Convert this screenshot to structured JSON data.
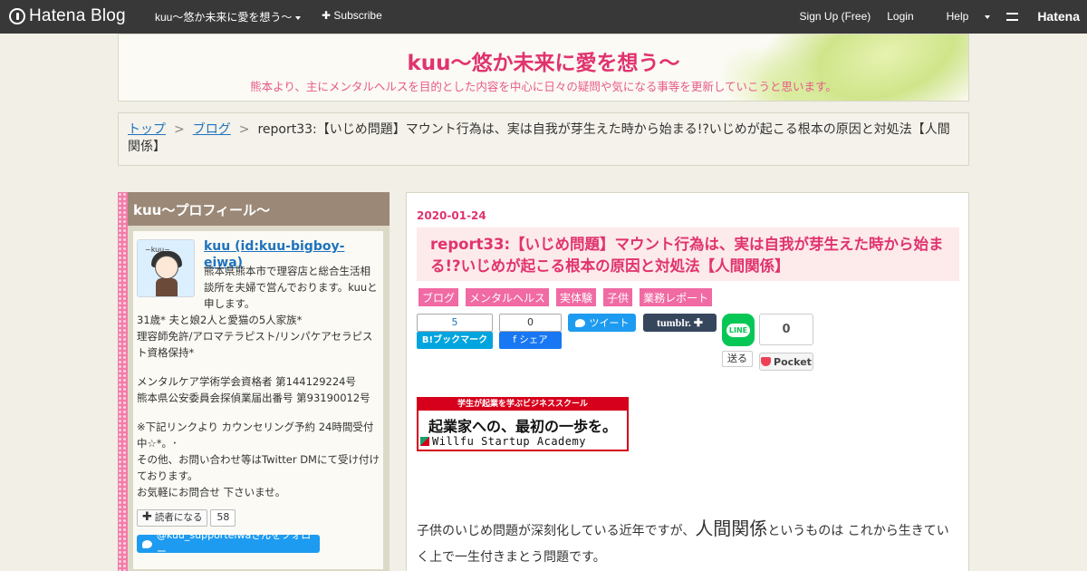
{
  "topbar": {
    "logo_text": "Hatena Blog",
    "blog_name": "kuu～悠か未来に愛を想う～",
    "subscribe": "Subscribe",
    "signup": "Sign Up (Free)",
    "login": "Login",
    "help": "Help",
    "hatena": "Hatena"
  },
  "header": {
    "title": "kuu～悠か未来に愛を想う～",
    "description": "熊本より、主にメンタルヘルスを目的とした内容を中心に日々の疑問や気になる事等を更新していこうと思います。"
  },
  "breadcrumb": {
    "top": "トップ",
    "blog": "ブログ",
    "sep": ">",
    "current": "report33:【いじめ問題】マウント行為は、実は自我が芽生えた時から始まる!?いじめが起こる根本の原因と対処法【人間関係】"
  },
  "sidebar": {
    "module_title": "kuu～プロフィール～",
    "avatar_caption": "~kuu~",
    "profile_name": "kuu (id:kuu-bigboy-eiwa)",
    "intro": "熊本県熊本市で理容店と総合生活相談所を夫婦で営んでおります。kuuと申します。",
    "line1": "31歳* 夫と娘2人と愛猫の5人家族*",
    "line2": "理容師免許/アロマテラピスト/リンパケアセラピスト資格保持*",
    "line3": "メンタルケア学術学会資格者 第144129224号",
    "line4": "熊本県公安委員会探偵業届出番号 第93190012号",
    "line5": "※下記リンクより カウンセリング予約 24時間受付中☆*。･",
    "line6": "その他、お問い合わせ等はTwitter DMにて受け付けております。",
    "line7": "お気軽にお問合せ 下さいませ。",
    "reader_button": "読者になる",
    "reader_count": "58",
    "twitter_follow": "@kuu_supporteiwaさんをフォロー"
  },
  "entry": {
    "date": "2020-01-24",
    "title": "report33:【いじめ問題】マウント行為は、実は自我が芽生えた時から始まる!?いじめが起こる根本の原因と対処法【人間関係】",
    "categories": [
      "ブログ",
      "メンタルヘルス",
      "実体験",
      "子供",
      "業務レポート"
    ],
    "share": {
      "hatebu_count": "5",
      "hatebu_label": "B!ブックマーク",
      "fb_count": "0",
      "fb_label": "f シェア",
      "tweet_label": "ツイート",
      "tumblr_label": "tumblr.",
      "line_icon": "LINE",
      "line_send": "送る",
      "pocket_count": "0",
      "pocket_label": "Pocket"
    },
    "banner": {
      "top": "学生が起業を学ぶビジネススクール",
      "mid": "起業家への、最初の一歩を。",
      "bottom": "Willfu Startup Academy"
    },
    "body_pre": "子供のいじめ問題が深刻化している近年ですが、",
    "body_big": "人間関係",
    "body_post": "というものは これから生きていく上で一生付きまとう問題です。"
  },
  "colors": {
    "accent": "#e0336f",
    "topbar": "#383838",
    "sidebar_title": "#9b8877",
    "category": "#f06aa3"
  }
}
